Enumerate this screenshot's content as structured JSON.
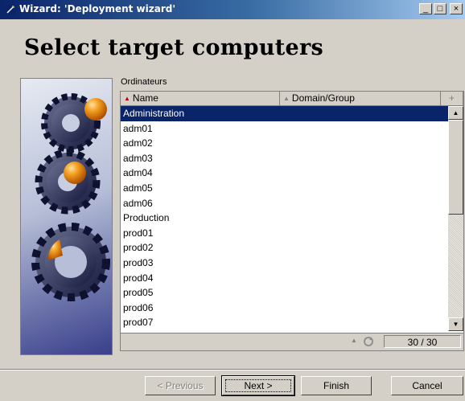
{
  "window": {
    "title": "Wizard: 'Deployment wizard'"
  },
  "title_buttons": {
    "minimize": "_",
    "maximize": "□",
    "close": "×"
  },
  "page": {
    "heading": "Select target computers"
  },
  "list": {
    "title": "Ordinateurs",
    "columns": [
      "Name",
      "Domain/Group"
    ],
    "rows": [
      "Administration",
      "adm01",
      "adm02",
      "adm03",
      "adm04",
      "adm05",
      "adm06",
      "Production",
      "prod01",
      "prod02",
      "prod03",
      "prod04",
      "prod05",
      "prod06",
      "prod07"
    ],
    "selected_row": "Administration",
    "count": "30 / 30"
  },
  "buttons": {
    "previous": "< Previous",
    "next": "Next >",
    "finish": "Finish",
    "cancel": "Cancel"
  },
  "colors": {
    "titlebar_start": "#0a246a",
    "selection": "#0a246a",
    "face": "#d4d0c8",
    "orange": "#f08a00"
  }
}
